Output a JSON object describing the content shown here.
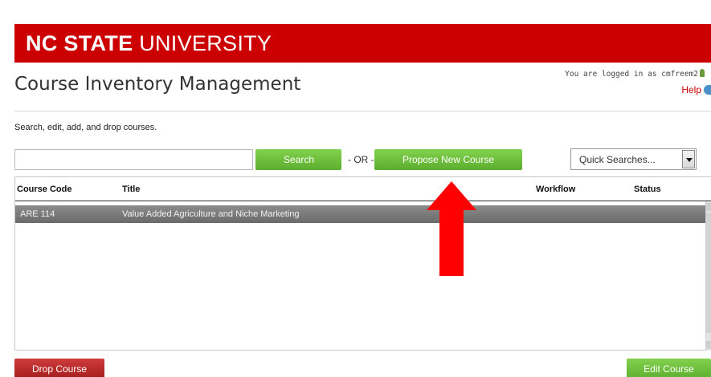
{
  "banner": {
    "logo_bold": "NC STATE",
    "logo_light": " UNIVERSITY"
  },
  "header": {
    "title": "Course Inventory Management",
    "login_text": "You are logged in as cmfreem2",
    "help_label": "Help"
  },
  "intro": {
    "subtitle": "Search, edit, add, and drop courses."
  },
  "search": {
    "value": "",
    "placeholder": "",
    "search_label": "Search",
    "or_label": "- OR -",
    "propose_label": "Propose New Course",
    "quick_searches": "Quick Searches..."
  },
  "table": {
    "columns": [
      "Course Code",
      "Title",
      "Workflow",
      "Status"
    ],
    "rows": [
      {
        "code": "ARE 114",
        "title": "Value Added Agriculture and Niche Marketing",
        "workflow": "",
        "status": ""
      }
    ]
  },
  "footer": {
    "drop_label": "Drop Course",
    "edit_label": "Edit Course"
  },
  "colors": {
    "brand_red": "#cc0000",
    "button_green": "#6cbf3c",
    "button_red": "#b32424",
    "annotation_arrow": "#ff0000"
  },
  "icons": {
    "user": "user-icon",
    "help": "help-icon",
    "dropdown": "chevron-down-icon",
    "annotation": "arrow-up-icon"
  }
}
